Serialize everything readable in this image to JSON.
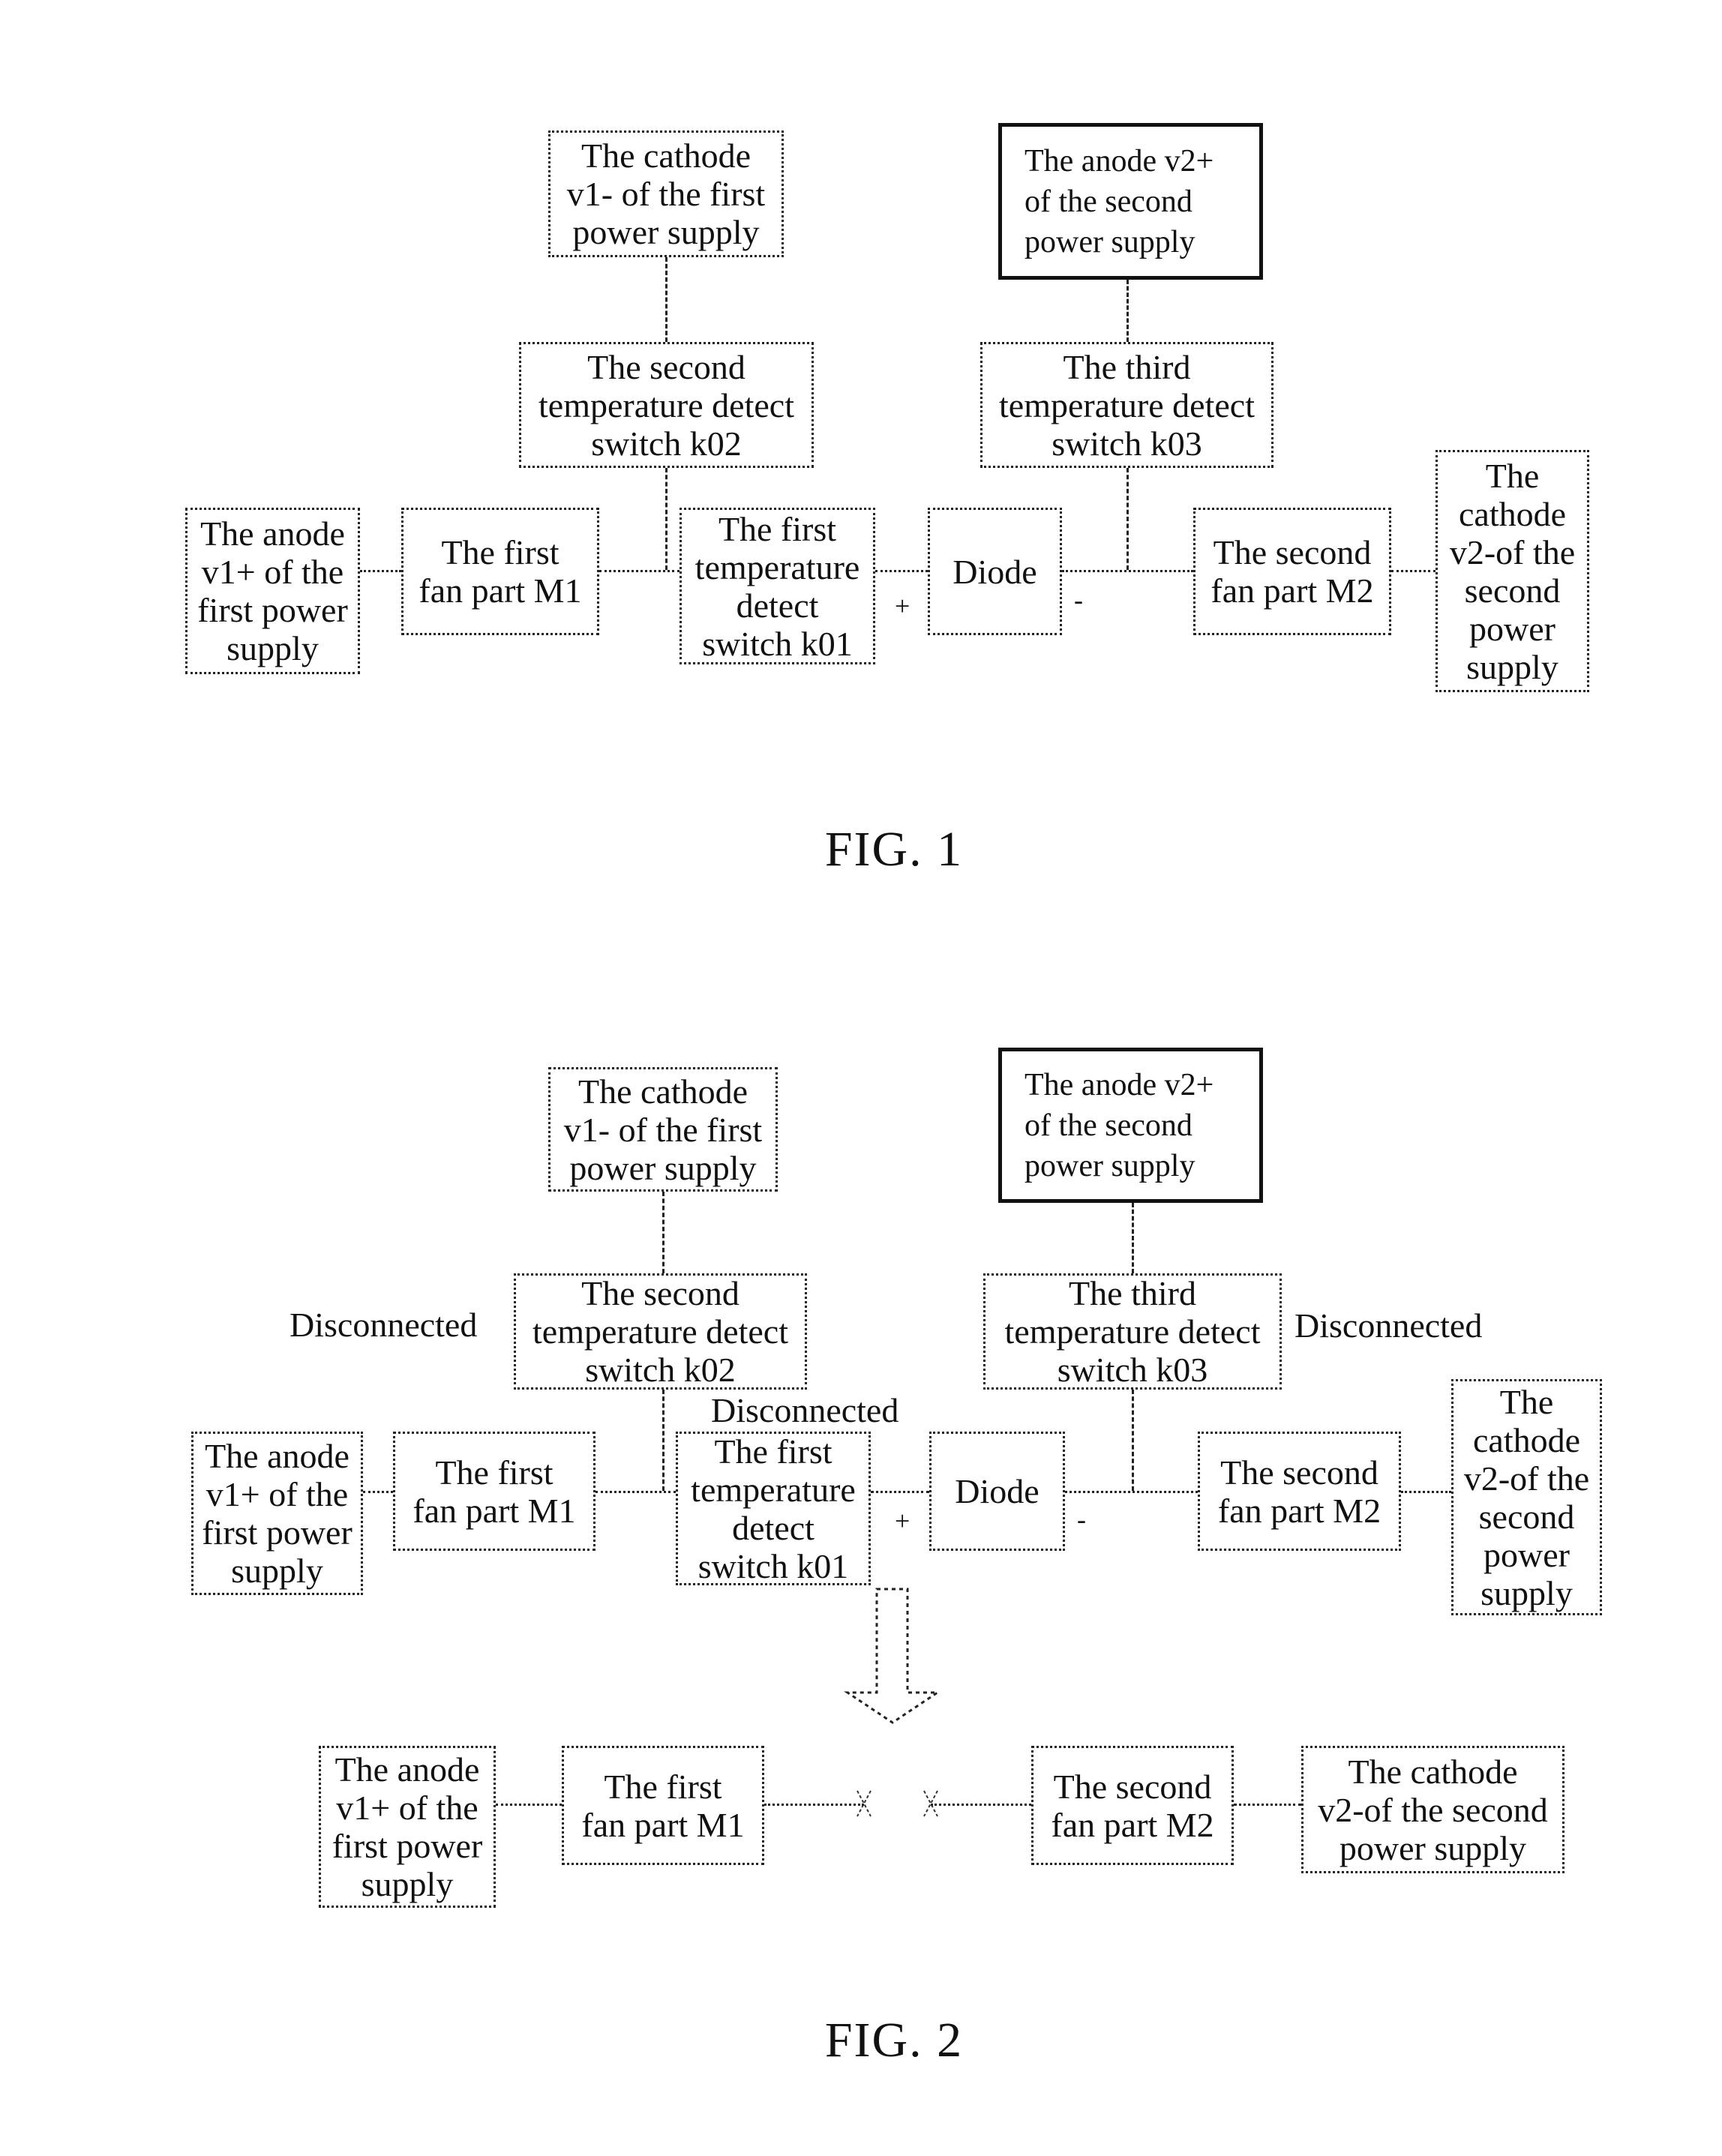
{
  "fig1": {
    "caption": "FIG. 1",
    "cathode_v1": "The cathode\nv1- of the first\npower supply",
    "anode_v2": "The anode v2+\nof   the   second\npower supply",
    "switch_k02": "The second\ntemperature detect\nswitch k02",
    "switch_k03": "The third\ntemperature detect\nswitch k03",
    "anode_v1": "The anode\nv1+ of the\nfirst power\nsupply",
    "fan_m1": "The first\nfan part M1",
    "switch_k01": "The first\ntemperature\ndetect\nswitch k01",
    "diode": "Diode",
    "fan_m2": "The second\nfan part M2",
    "cathode_v2": "The\ncathode\nv2-of the\nsecond\npower\nsupply",
    "plus_sign": "+",
    "minus_sign": "-"
  },
  "fig2": {
    "caption": "FIG. 2",
    "cathode_v1": "The cathode\nv1- of the first\npower supply",
    "anode_v2": "The anode v2+\nof   the   second\npower supply",
    "switch_k02": "The second\ntemperature detect\nswitch k02",
    "switch_k03": "The third\ntemperature detect\nswitch k03",
    "anode_v1": "The anode\nv1+ of the\nfirst power\nsupply",
    "fan_m1": "The first\nfan part M1",
    "switch_k01": "The first\ntemperature\ndetect\nswitch k01",
    "diode": "Diode",
    "fan_m2": "The second\nfan part M2",
    "cathode_v2": "The\ncathode\nv2-of the\nsecond\npower\nsupply",
    "plus_sign": "+",
    "minus_sign": "-",
    "disconnected_k02": "Disconnected",
    "disconnected_k03": "Disconnected",
    "disconnected_k01": "Disconnected",
    "result": {
      "anode_v1": "The anode\nv1+ of the\nfirst power\nsupply",
      "fan_m1": "The first\nfan part M1",
      "fan_m2": "The second\nfan part M2",
      "cathode_v2": "The cathode\nv2-of the second\npower supply"
    }
  }
}
